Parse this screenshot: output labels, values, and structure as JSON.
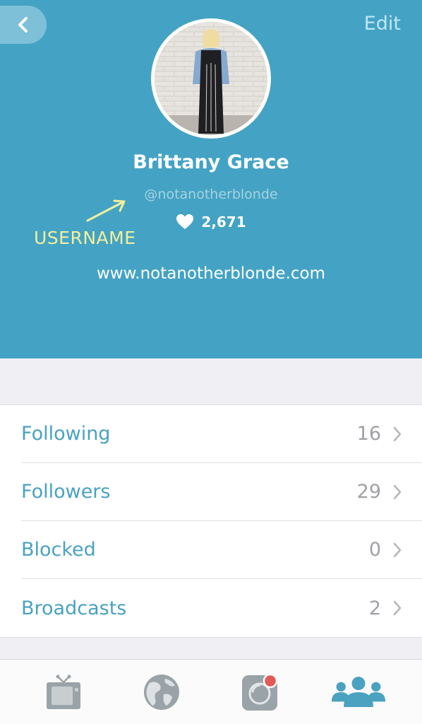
{
  "header": {
    "edit_label": "Edit",
    "name": "Brittany Grace",
    "username": "@notanotherblonde",
    "hearts_count": "2,671",
    "website": "www.notanotherblonde.com",
    "annotation_label": "USERNAME"
  },
  "list": [
    {
      "label": "Following",
      "count": "16"
    },
    {
      "label": "Followers",
      "count": "29"
    },
    {
      "label": "Blocked",
      "count": "0"
    },
    {
      "label": "Broadcasts",
      "count": "2"
    }
  ],
  "tabs": [
    {
      "icon": "tv-icon",
      "active": false
    },
    {
      "icon": "globe-icon",
      "active": false
    },
    {
      "icon": "camera-icon",
      "active": false
    },
    {
      "icon": "people-icon",
      "active": true
    }
  ],
  "colors": {
    "header_bg": "#44a3c4",
    "accent": "#4aa2c0",
    "annotation": "#f2ef9c",
    "record_dot": "#e25a56"
  }
}
